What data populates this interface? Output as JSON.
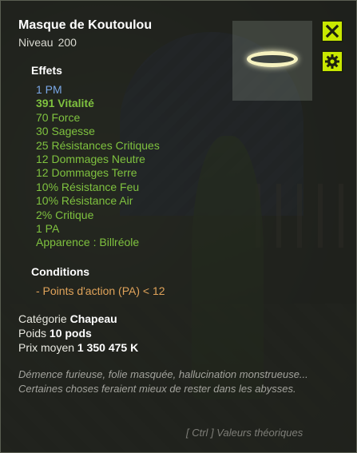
{
  "item": {
    "name": "Masque de Koutoulou",
    "level_label": "Niveau",
    "level_value": "200"
  },
  "effects_heading": "Effets",
  "effects": [
    {
      "text": "1 PM",
      "kind": "ap"
    },
    {
      "text": "391 Vitalité",
      "kind": "bold"
    },
    {
      "text": "70 Force",
      "kind": "normal"
    },
    {
      "text": "30 Sagesse",
      "kind": "normal"
    },
    {
      "text": "25 Résistances Critiques",
      "kind": "normal"
    },
    {
      "text": "12 Dommages Neutre",
      "kind": "normal"
    },
    {
      "text": "12 Dommages Terre",
      "kind": "normal"
    },
    {
      "text": "10% Résistance Feu",
      "kind": "normal"
    },
    {
      "text": "10% Résistance Air",
      "kind": "normal"
    },
    {
      "text": "2% Critique",
      "kind": "normal"
    },
    {
      "text": "1 PA",
      "kind": "normal"
    },
    {
      "text": "Apparence : Billréole",
      "kind": "normal"
    }
  ],
  "conditions_heading": "Conditions",
  "conditions": [
    "- Points d'action (PA) < 12"
  ],
  "details": {
    "category_label": "Catégorie",
    "category_value": "Chapeau",
    "weight_label": "Poids",
    "weight_value": "10 pods",
    "price_label": "Prix moyen",
    "price_value": "1 350 475 K"
  },
  "description": "Démence furieuse, folie masquée, hallucination monstrueuse... Certaines choses feraient mieux de rester dans les abysses.",
  "footer_hint": "[ Ctrl ] Valeurs théoriques",
  "icons": {
    "close": "close-icon",
    "settings": "gear-icon"
  },
  "colors": {
    "accent_button": "#c8e800",
    "effect_green": "#7fc23f",
    "effect_blue": "#7aa7e6",
    "condition_orange": "#e0a35a"
  }
}
